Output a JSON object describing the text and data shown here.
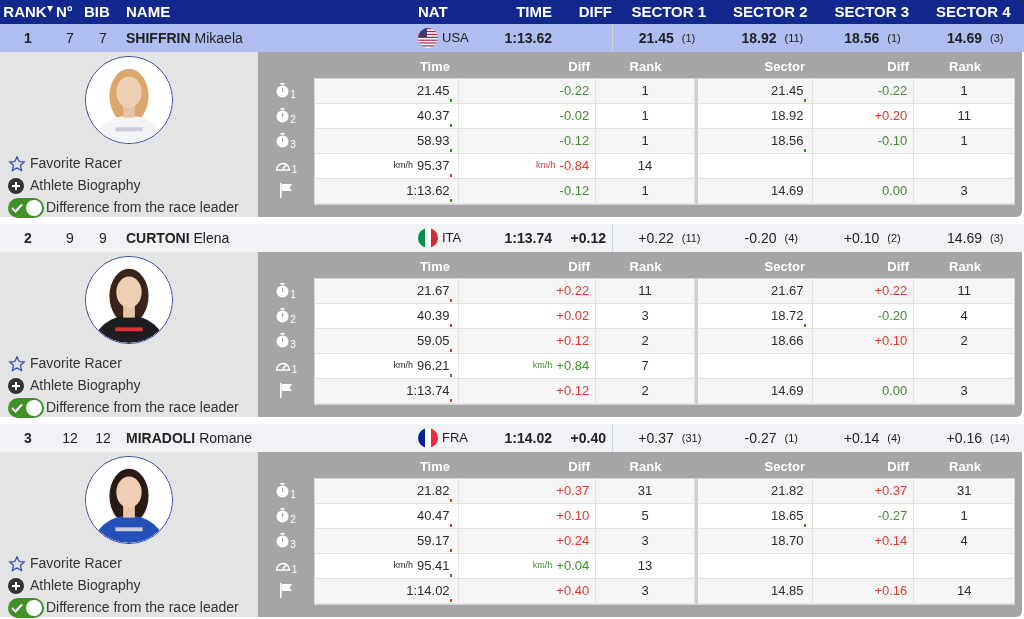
{
  "columns": [
    {
      "label": "RANK",
      "sorted": true
    },
    {
      "label": "N°",
      "sorted": false
    },
    {
      "label": "BIB",
      "sorted": false
    },
    {
      "label": "NAME",
      "sorted": false
    },
    {
      "label": "NAT",
      "sorted": false
    },
    {
      "label": "TIME",
      "sorted": false
    },
    {
      "label": "DIFF",
      "sorted": false
    },
    {
      "label": "SECTOR 1",
      "sorted": false
    },
    {
      "label": "SECTOR 2",
      "sorted": false
    },
    {
      "label": "SECTOR 3",
      "sorted": false
    },
    {
      "label": "SECTOR 4",
      "sorted": false
    }
  ],
  "athletes": [
    {
      "selected": true,
      "rank": "1",
      "no": "7",
      "bib": "7",
      "surname": "SHIFFRIN",
      "given": "Mikaela",
      "flag": {
        "kind": "usa"
      },
      "nat": "USA",
      "time": "1:13.62",
      "sectors": [
        {
          "value": "21.45",
          "rank": "(1)"
        },
        {
          "value": "18.92",
          "rank": "(11)"
        },
        {
          "value": "18.56",
          "rank": "(1)"
        },
        {
          "value": "14.69",
          "rank": "(3)"
        }
      ],
      "favorite": {
        "label": "Favorite Racer",
        "on": false
      },
      "biography": "Athlete Biography",
      "leader_diff": {
        "label": "Difference from the race leader",
        "on": true
      },
      "split_columns": [
        "Time",
        "Diff",
        "Rank",
        "Sector",
        "Diff",
        "Rank"
      ],
      "splits": [
        {
          "kind": "split",
          "index": "1",
          "time": "21.45",
          "diff": "-0.22",
          "ahead": true,
          "rank": "1",
          "sector": "21.45",
          "sector_diff": "-0.22",
          "sector_ahead": true,
          "sector_rank": "1"
        },
        {
          "kind": "split",
          "index": "2",
          "time": "40.37",
          "diff": "-0.02",
          "ahead": true,
          "rank": "1",
          "sector": "18.92",
          "sector_diff": "+0.20",
          "sector_ahead": false,
          "sector_rank": "11"
        },
        {
          "kind": "split",
          "index": "3",
          "time": "58.93",
          "diff": "-0.12",
          "ahead": true,
          "rank": "1",
          "sector": "18.56",
          "sector_diff": "-0.10",
          "sector_ahead": true,
          "sector_rank": "1"
        },
        {
          "kind": "speed",
          "index": "1",
          "unit": "km/h",
          "time": "95.37",
          "diff_unit": "km/h",
          "diff": "-0.84",
          "ahead": false,
          "rank": "14"
        },
        {
          "kind": "finish",
          "time": "1:13.62",
          "diff": "-0.12",
          "ahead": true,
          "rank": "1",
          "sector": "14.69",
          "sector_diff": "0.00",
          "sector_ahead": true,
          "sector_rank": "3"
        }
      ]
    },
    {
      "selected": false,
      "rank": "2",
      "no": "9",
      "bib": "9",
      "surname": "CURTONI",
      "given": "Elena",
      "flag": {
        "kind": "ita"
      },
      "nat": "ITA",
      "time": "1:13.74",
      "diff": "+0.12",
      "sectors": [
        {
          "value": "+0.22",
          "rank": "(11)"
        },
        {
          "value": "-0.20",
          "rank": "(4)"
        },
        {
          "value": "+0.10",
          "rank": "(2)"
        },
        {
          "value": "14.69",
          "rank": "(3)"
        }
      ],
      "favorite": {
        "label": "Favorite Racer",
        "on": false
      },
      "biography": "Athlete Biography",
      "leader_diff": {
        "label": "Difference from the race leader",
        "on": true
      },
      "split_columns": [
        "Time",
        "Diff",
        "Rank",
        "Sector",
        "Diff",
        "Rank"
      ],
      "splits": [
        {
          "kind": "split",
          "index": "1",
          "time": "21.67",
          "diff": "+0.22",
          "ahead": false,
          "rank": "11",
          "sector": "21.67",
          "sector_diff": "+0.22",
          "sector_ahead": false,
          "sector_rank": "11"
        },
        {
          "kind": "split",
          "index": "2",
          "time": "40.39",
          "diff": "+0.02",
          "ahead": false,
          "rank": "3",
          "sector": "18.72",
          "sector_diff": "-0.20",
          "sector_ahead": true,
          "sector_rank": "4"
        },
        {
          "kind": "split",
          "index": "3",
          "time": "59.05",
          "diff": "+0.12",
          "ahead": false,
          "rank": "2",
          "sector": "18.66",
          "sector_diff": "+0.10",
          "sector_ahead": false,
          "sector_rank": "2"
        },
        {
          "kind": "speed",
          "index": "1",
          "unit": "km/h",
          "time": "96.21",
          "diff_unit": "km/h",
          "diff": "+0.84",
          "ahead": true,
          "rank": "7"
        },
        {
          "kind": "finish",
          "time": "1:13.74",
          "diff": "+0.12",
          "ahead": false,
          "rank": "2",
          "sector": "14.69",
          "sector_diff": "0.00",
          "sector_ahead": true,
          "sector_rank": "3"
        }
      ]
    },
    {
      "selected": false,
      "rank": "3",
      "no": "12",
      "bib": "12",
      "surname": "MIRADOLI",
      "given": "Romane",
      "flag": {
        "kind": "fra"
      },
      "nat": "FRA",
      "time": "1:14.02",
      "diff": "+0.40",
      "sectors": [
        {
          "value": "+0.37",
          "rank": "(31)"
        },
        {
          "value": "-0.27",
          "rank": "(1)"
        },
        {
          "value": "+0.14",
          "rank": "(4)"
        },
        {
          "value": "+0.16",
          "rank": "(14)"
        }
      ],
      "favorite": {
        "label": "Favorite Racer",
        "on": false
      },
      "biography": "Athlete Biography",
      "leader_diff": {
        "label": "Difference from the race leader",
        "on": true
      },
      "split_columns": [
        "Time",
        "Diff",
        "Rank",
        "Sector",
        "Diff",
        "Rank"
      ],
      "splits": [
        {
          "kind": "split",
          "index": "1",
          "time": "21.82",
          "diff": "+0.37",
          "ahead": false,
          "rank": "31",
          "sector": "21.82",
          "sector_diff": "+0.37",
          "sector_ahead": false,
          "sector_rank": "31"
        },
        {
          "kind": "split",
          "index": "2",
          "time": "40.47",
          "diff": "+0.10",
          "ahead": false,
          "rank": "5",
          "sector": "18.65",
          "sector_diff": "-0.27",
          "sector_ahead": true,
          "sector_rank": "1"
        },
        {
          "kind": "split",
          "index": "3",
          "time": "59.17",
          "diff": "+0.24",
          "ahead": false,
          "rank": "3",
          "sector": "18.70",
          "sector_diff": "+0.14",
          "sector_ahead": false,
          "sector_rank": "4"
        },
        {
          "kind": "speed",
          "index": "1",
          "unit": "km/h",
          "time": "95.41",
          "diff_unit": "km/h",
          "diff": "+0.04",
          "ahead": true,
          "rank": "13"
        },
        {
          "kind": "finish",
          "time": "1:14.02",
          "diff": "+0.40",
          "ahead": false,
          "rank": "3",
          "sector": "14.85",
          "sector_diff": "+0.16",
          "sector_ahead": false,
          "sector_rank": "14"
        }
      ]
    }
  ]
}
